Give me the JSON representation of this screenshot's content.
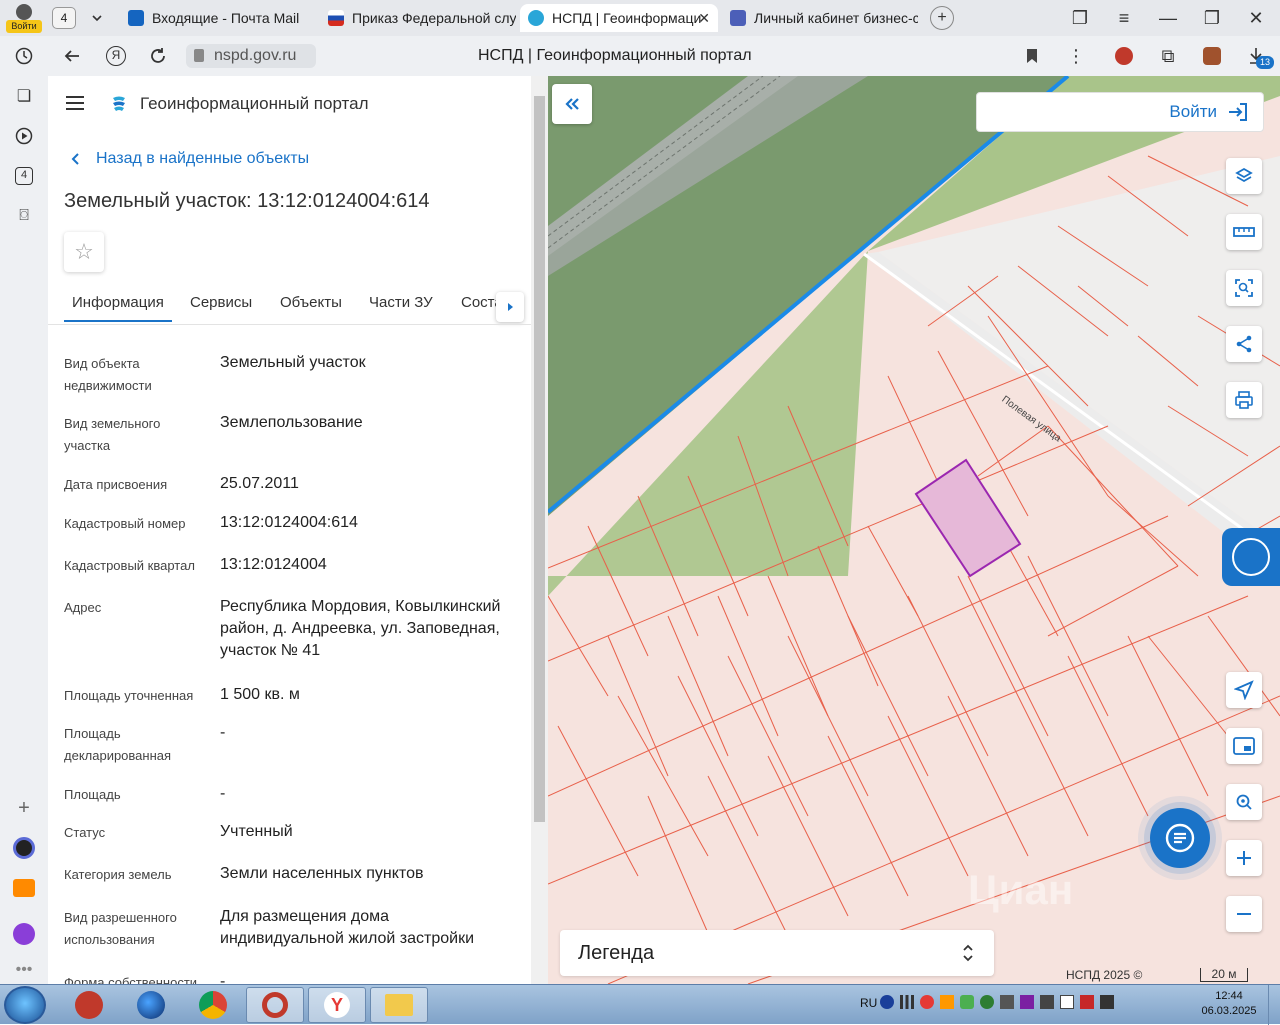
{
  "browser": {
    "profile_badge": "Войти",
    "tab_count": "4",
    "tabs": [
      {
        "label": "Входящие - Почта Mail",
        "active": false
      },
      {
        "label": "Приказ Федеральной слу",
        "active": false
      },
      {
        "label": "НСПД | Геоинформаци",
        "active": true
      },
      {
        "label": "Личный кабинет бизнес-с",
        "active": false
      }
    ],
    "url": "nspd.gov.ru",
    "page_title": "НСПД | Геоинформационный портал",
    "downloads_badge": "13",
    "sidebar_badge": "4"
  },
  "app": {
    "title": "Геоинформационный портал",
    "back_link": "Назад в найденные объекты",
    "object_heading": "Земельный участок: 13:12:0124004:614",
    "tabs": [
      "Информация",
      "Сервисы",
      "Объекты",
      "Части ЗУ",
      "Соста"
    ],
    "active_tab": "Информация"
  },
  "info_rows": [
    {
      "label": "Вид объекта недвижимости",
      "value": "Земельный участок"
    },
    {
      "label": "Вид земельного участка",
      "value": "Землепользование"
    },
    {
      "label": "Дата присвоения",
      "value": "25.07.2011"
    },
    {
      "label": "Кадастровый номер",
      "value": "13:12:0124004:614"
    },
    {
      "label": "Кадастровый квартал",
      "value": "13:12:0124004"
    },
    {
      "label": "Адрес",
      "value": "Республика Мордовия, Ковылкинский район, д. Андреевка, ул. Заповедная, участок № 41"
    },
    {
      "label": "Площадь уточненная",
      "value": "1 500 кв. м"
    },
    {
      "label": "Площадь декларированная",
      "value": "-"
    },
    {
      "label": "Площадь",
      "value": "-"
    },
    {
      "label": "Статус",
      "value": "Учтенный"
    },
    {
      "label": "Категория земель",
      "value": "Земли населенных пунктов"
    },
    {
      "label": "Вид разрешенного использования",
      "value": "Для размещения дома индивидуальной жилой застройки"
    },
    {
      "label": "Форма собственности",
      "value": "-"
    }
  ],
  "map": {
    "login_label": "Войти",
    "street_label": "Полевая улица",
    "legend_label": "Легенда",
    "copyright": "НСПД 2025 ©",
    "scale": "20 м",
    "watermark": "Циан",
    "colors": {
      "accent": "#1a73c8",
      "parcel_line": "#e8604a",
      "selected_fill": "#e6b8d8",
      "selected_stroke": "#9b27b0",
      "green_area": "#7a9a6e",
      "light_green": "#a9c48a",
      "border_blue": "#1a8ae8"
    }
  },
  "taskbar": {
    "lang": "RU",
    "time": "12:44",
    "date": "06.03.2025"
  }
}
